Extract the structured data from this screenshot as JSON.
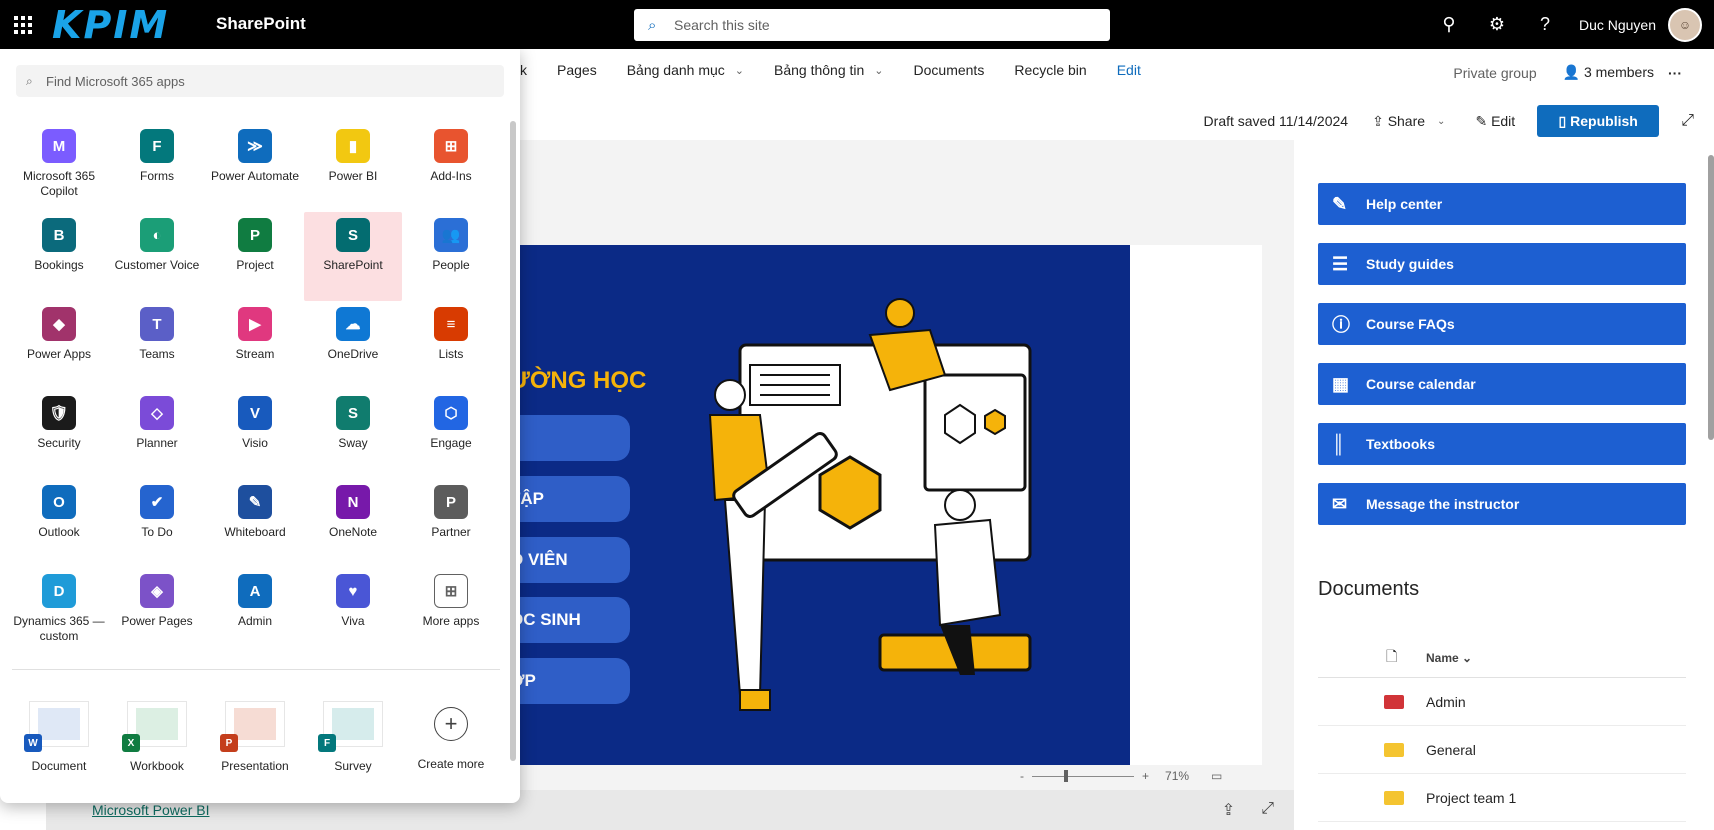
{
  "topbar": {
    "logo_text": "KPIM",
    "app_name": "SharePoint",
    "search_placeholder": "Search this site",
    "user_name": "Duc Nguyen"
  },
  "nav": {
    "partial_item": "k",
    "items": [
      "Pages",
      "Bảng danh mục",
      "Bảng thông tin",
      "Documents",
      "Recycle bin",
      "Edit"
    ],
    "privacy": "Private group",
    "members": "3 members"
  },
  "command_bar": {
    "draft_status": "Draft saved 11/14/2024",
    "share": "Share",
    "edit": "Edit",
    "republish": "Republish"
  },
  "banner": {
    "title": "ƯỜNG HỌC",
    "buttons": [
      "",
      "TẬP",
      "O VIÊN",
      "ỌC SINH",
      "ỚP"
    ]
  },
  "viewer": {
    "zoom_minus": "-",
    "zoom_plus": "+",
    "zoom_level": "71%",
    "footer_link": "Microsoft Power BI"
  },
  "quick_links": [
    {
      "label": "Help center",
      "icon": "clipboard-edit-icon"
    },
    {
      "label": "Study guides",
      "icon": "notepad-icon"
    },
    {
      "label": "Course FAQs",
      "icon": "info-icon"
    },
    {
      "label": "Course calendar",
      "icon": "calendar-icon"
    },
    {
      "label": "Textbooks",
      "icon": "library-icon"
    },
    {
      "label": "Message the instructor",
      "icon": "mail-icon"
    }
  ],
  "documents": {
    "title": "Documents",
    "column_name": "Name",
    "rows": [
      {
        "name": "Admin",
        "color": "#d13438"
      },
      {
        "name": "General",
        "color": "#f4c430"
      },
      {
        "name": "Project team 1",
        "color": "#f4c430"
      }
    ]
  },
  "launcher": {
    "search_placeholder": "Find Microsoft 365 apps",
    "apps": [
      {
        "label": "Microsoft 365 Copilot",
        "icon": "M",
        "color": "#7b5cff"
      },
      {
        "label": "Forms",
        "icon": "F",
        "color": "#03787c"
      },
      {
        "label": "Power Automate",
        "icon": "≫",
        "color": "#0f6cbd"
      },
      {
        "label": "Power BI",
        "icon": "▮",
        "color": "#f2c811"
      },
      {
        "label": "Add-Ins",
        "icon": "⊞",
        "color": "#e8542f"
      },
      {
        "label": "Bookings",
        "icon": "B",
        "color": "#0b6a7c"
      },
      {
        "label": "Customer Voice",
        "icon": "◐",
        "color": "#1b9e77"
      },
      {
        "label": "Project",
        "icon": "P",
        "color": "#107c41"
      },
      {
        "label": "SharePoint",
        "icon": "S",
        "color": "#036c70"
      },
      {
        "label": "People",
        "icon": "👥",
        "color": "#2b6fd6"
      },
      {
        "label": "Power Apps",
        "icon": "◆",
        "color": "#a1336b"
      },
      {
        "label": "Teams",
        "icon": "T",
        "color": "#5b5fc7"
      },
      {
        "label": "Stream",
        "icon": "▶",
        "color": "#e0387f"
      },
      {
        "label": "OneDrive",
        "icon": "☁",
        "color": "#0f78d4"
      },
      {
        "label": "Lists",
        "icon": "≡",
        "color": "#d83b01"
      },
      {
        "label": "Security",
        "icon": "🛡",
        "color": "#1b1b1b"
      },
      {
        "label": "Planner",
        "icon": "◇",
        "color": "#7b4bd8"
      },
      {
        "label": "Visio",
        "icon": "V",
        "color": "#185abd"
      },
      {
        "label": "Sway",
        "icon": "S",
        "color": "#107c6e"
      },
      {
        "label": "Engage",
        "icon": "⬡",
        "color": "#2266e3"
      },
      {
        "label": "Outlook",
        "icon": "O",
        "color": "#0f6cbd"
      },
      {
        "label": "To Do",
        "icon": "✔",
        "color": "#2564cf"
      },
      {
        "label": "Whiteboard",
        "icon": "✎",
        "color": "#1e4f9e"
      },
      {
        "label": "OneNote",
        "icon": "N",
        "color": "#7719aa"
      },
      {
        "label": "Partner",
        "icon": "P",
        "color": "#5c5c5c"
      },
      {
        "label": "Dynamics 365 — custom",
        "icon": "D",
        "color": "#1f9bd8"
      },
      {
        "label": "Power Pages",
        "icon": "◈",
        "color": "#7c52c8"
      },
      {
        "label": "Admin",
        "icon": "A",
        "color": "#0f6cbd"
      },
      {
        "label": "Viva",
        "icon": "♥",
        "color": "#4a56d6"
      },
      {
        "label": "More apps",
        "icon": "⊞",
        "color": "#ffffff"
      }
    ],
    "create": [
      {
        "label": "Document",
        "badge": "W",
        "badge_color": "#185abd",
        "fill": "#dfe8f6"
      },
      {
        "label": "Workbook",
        "badge": "X",
        "badge_color": "#107c41",
        "fill": "#dcefe3"
      },
      {
        "label": "Presentation",
        "badge": "P",
        "badge_color": "#c43e1c",
        "fill": "#f6dcd4"
      },
      {
        "label": "Survey",
        "badge": "F",
        "badge_color": "#03787c",
        "fill": "#d6ecec"
      },
      {
        "label": "Create more",
        "badge": "",
        "badge_color": "",
        "fill": ""
      }
    ]
  }
}
